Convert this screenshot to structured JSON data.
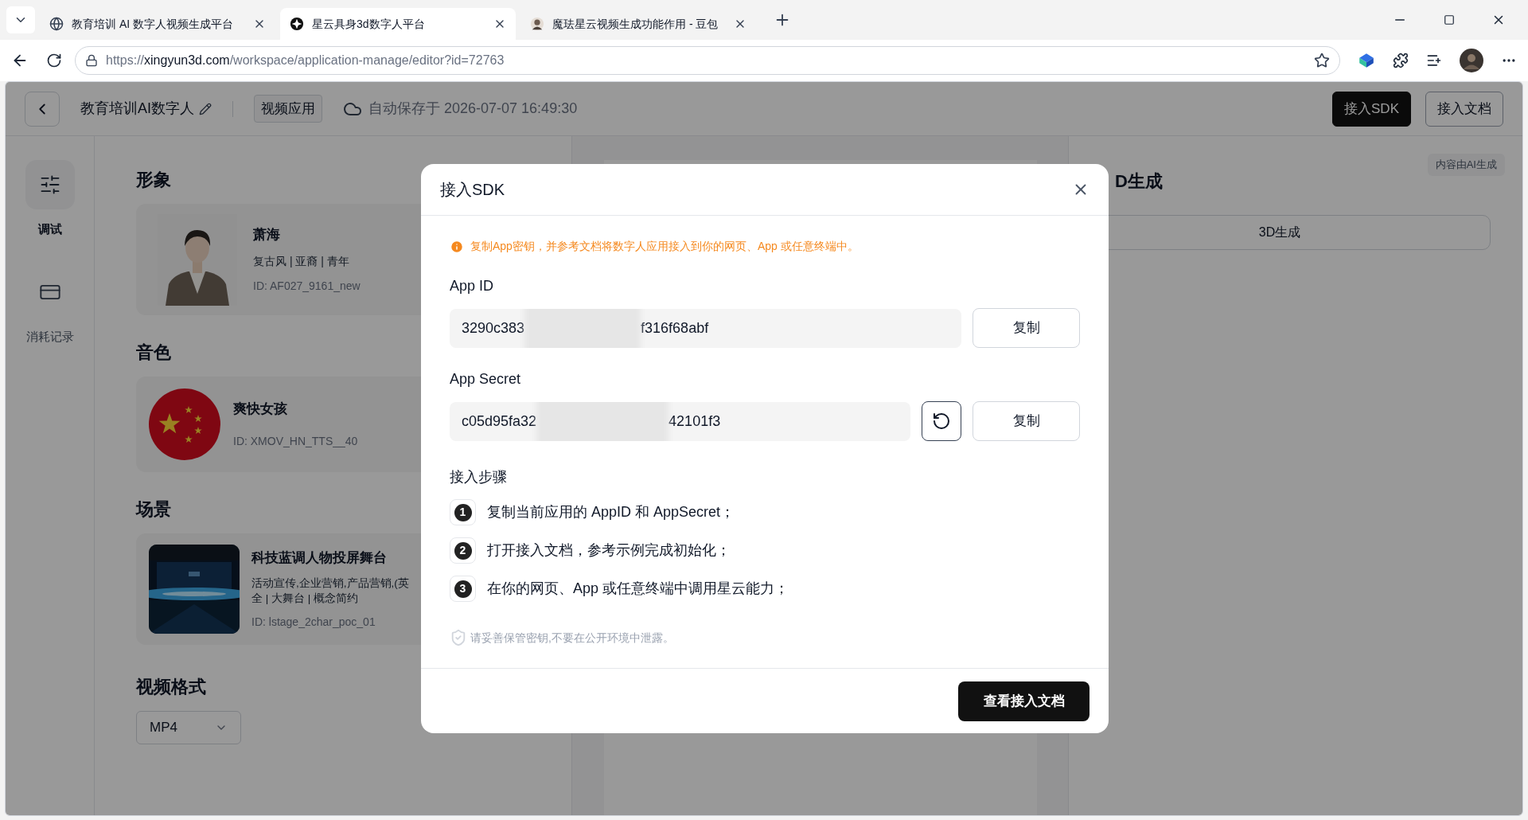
{
  "browser": {
    "tabs": [
      {
        "title": "教育培训 AI 数字人视频生成平台",
        "selected": false
      },
      {
        "title": "星云具身3d数字人平台",
        "selected": true
      },
      {
        "title": "魔珐星云视频生成功能作用 - 豆包",
        "selected": false
      }
    ],
    "url": {
      "scheme": "https://",
      "host": "xingyun3d.com",
      "path": "/workspace/application-manage/editor?id=72763"
    }
  },
  "header": {
    "app_name": "教育培训AI数字人",
    "tag": "视频应用",
    "autosave": "自动保存于 2026-07-07 16:49:30",
    "buttons": [
      {
        "label": "接入SDK",
        "kind": "primary"
      },
      {
        "label": "接入文档",
        "kind": "outline"
      }
    ]
  },
  "nav": [
    {
      "label": "调试",
      "selected": true
    },
    {
      "label": "消耗记录",
      "selected": false
    }
  ],
  "avatar_section": {
    "heading": "形象",
    "name": "萧海",
    "tags": "复古风 | 亚裔 | 青年",
    "id": "ID: AF027_9161_new"
  },
  "voice_section": {
    "heading": "音色",
    "name": "爽快女孩",
    "id": "ID: XMOV_HN_TTS__40"
  },
  "scene_section": {
    "heading": "场景",
    "name": "科技蓝调人物投屏舞台",
    "tags": [
      "活动宣传,企业营销,产品营销,(英",
      "全 | 大舞台 | 概念简约"
    ],
    "id": "ID: lstage_2char_poc_01"
  },
  "format_section": {
    "heading": "视频格式",
    "value": "MP4"
  },
  "right_panel": {
    "heading": "D生成",
    "badge": "内容由AI生成",
    "button": "3D生成"
  },
  "dialog": {
    "title": "接入SDK",
    "notice": "复制App密钥，并参考文档将数字人应用接入到你的网页、App 或任意终端中。",
    "fields": [
      {
        "label": "App ID",
        "value_start": "3290c383",
        "value_end": "f316f68abf",
        "copy": "复制",
        "refresh": false
      },
      {
        "label": "App Secret",
        "value_start": "c05d95fa32",
        "value_end": "42101f3",
        "copy": "复制",
        "refresh": true
      }
    ],
    "steps_heading": "接入步骤",
    "steps": [
      {
        "number": "1",
        "text": "复制当前应用的 AppID 和 AppSecret；"
      },
      {
        "number": "2",
        "text": "打开接入文档，参考示例完成初始化；"
      },
      {
        "number": "3",
        "text": "在你的网页、App 或任意终端中调用星云能力；"
      }
    ],
    "security_note": "请妥善保管密钥,不要在公开环境中泄露。",
    "action": "查看接入文档"
  }
}
